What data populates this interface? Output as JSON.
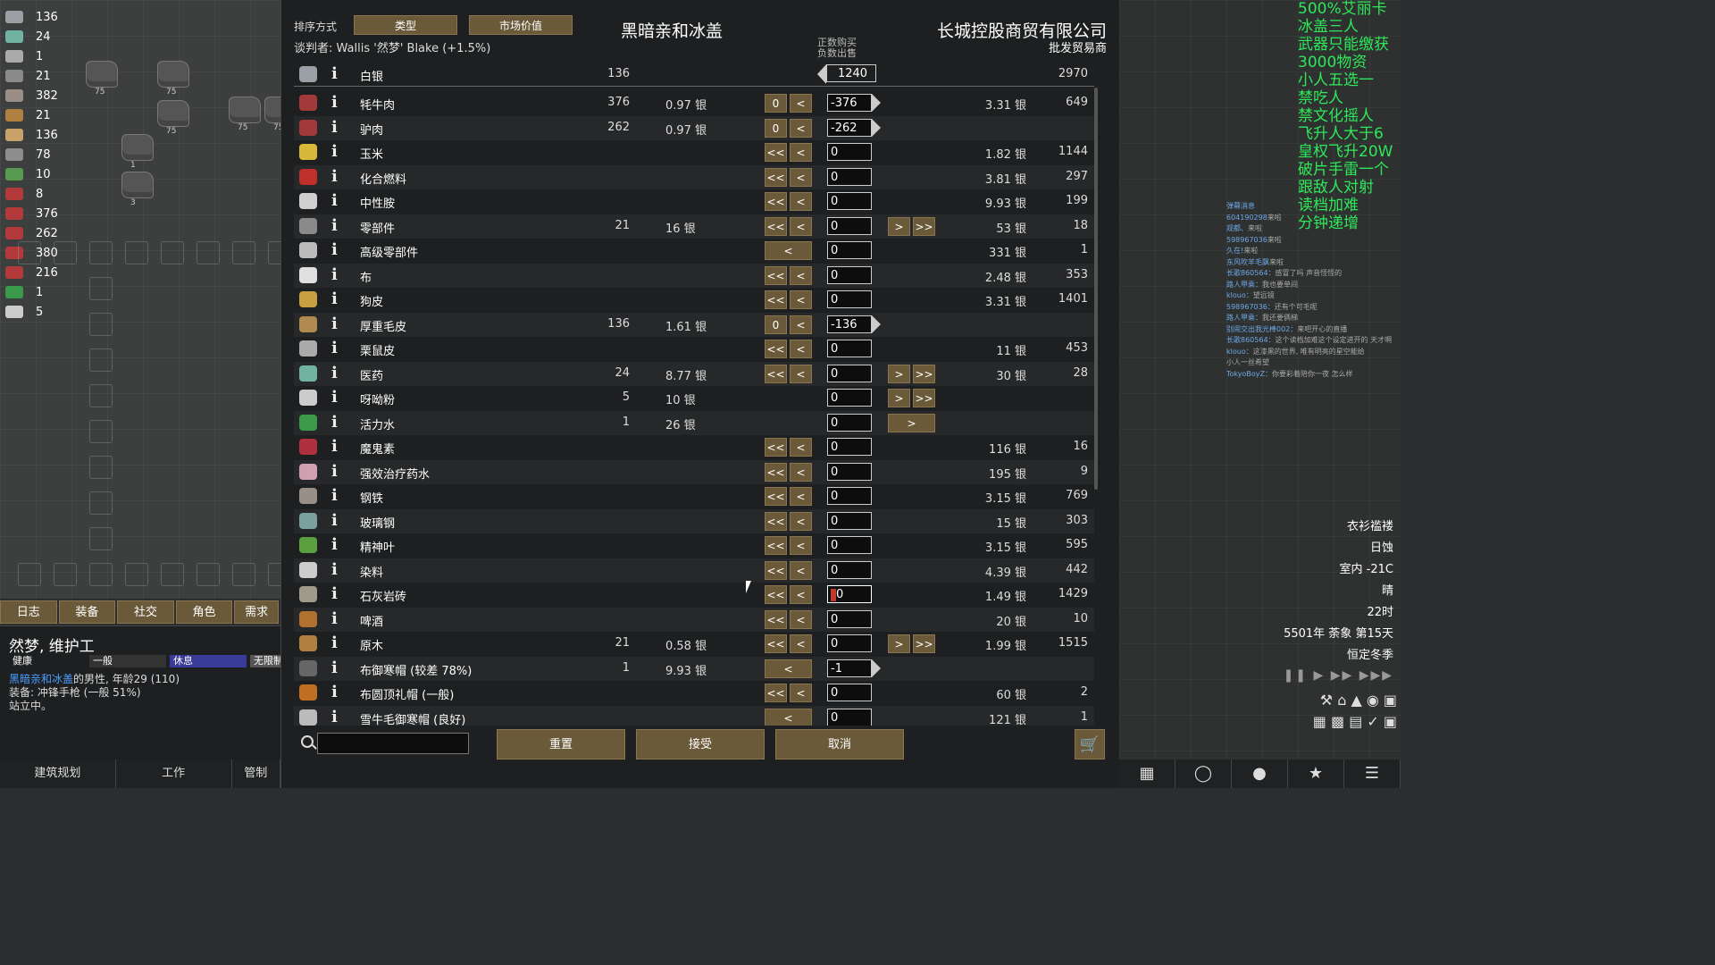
{
  "left_resources": [
    {
      "icon": "silver-icon",
      "count": "136",
      "color": "#9aa0a6"
    },
    {
      "icon": "medicine-icon",
      "count": "24",
      "color": "#6fb3a0"
    },
    {
      "icon": "yayo-icon",
      "count": "1",
      "color": "#aaaaaa"
    },
    {
      "icon": "components-icon",
      "count": "21",
      "color": "#8a8a8a"
    },
    {
      "icon": "steel-icon",
      "count": "382",
      "color": "#9a8f86"
    },
    {
      "icon": "wood-icon",
      "count": "21",
      "color": "#b08040"
    },
    {
      "icon": "leather-icon",
      "count": "136",
      "color": "#c9a26a"
    },
    {
      "icon": "dye-icon",
      "count": "78",
      "color": "#8d8d8d"
    },
    {
      "icon": "herb-icon",
      "count": "10",
      "color": "#5a9a50"
    },
    {
      "icon": "meat-icon",
      "count": "8",
      "color": "#b23a3a"
    },
    {
      "icon": "meat-icon",
      "count": "376",
      "color": "#b23a3a"
    },
    {
      "icon": "meat-icon",
      "count": "262",
      "color": "#b23a3a"
    },
    {
      "icon": "meat-icon",
      "count": "380",
      "color": "#b23a3a"
    },
    {
      "icon": "meat-icon",
      "count": "216",
      "color": "#b23a3a"
    },
    {
      "icon": "go-juice-icon",
      "count": "1",
      "color": "#3a9a4a"
    },
    {
      "icon": "flake-icon",
      "count": "5",
      "color": "#cccccc"
    }
  ],
  "map_rocks": [
    "75",
    "75",
    "75",
    "75",
    "1",
    "75",
    "3"
  ],
  "left_tabs": [
    "日志",
    "装备",
    "社交",
    "角色",
    "需求"
  ],
  "pawn": {
    "name": "然梦, 维护工",
    "needs": [
      "健康",
      "一般",
      "休息",
      "无限制"
    ],
    "faction_name": "黑暗亲和冰盖",
    "line1_rest": "的男性, 年龄29 (110)",
    "line2": "装备: 冲锋手枪 (一般 51%)",
    "line3": "站立中。"
  },
  "arch_tabs": [
    "建筑规划",
    "工作",
    "管制"
  ],
  "trade": {
    "sort_label": "排序方式",
    "sort_buttons": [
      "类型",
      "市场价值"
    ],
    "negotiator": "谈判者: Wallis '然梦' Blake (+1.5%)",
    "colony_name": "黑暗亲和冰盖",
    "trader_name": "长城控股商贸有限公司",
    "trader_kind": "批发贸易商",
    "buy_label": "正数购买",
    "sell_label": "负数出售",
    "silver": {
      "name": "白银",
      "colony": "136",
      "qty": "1240",
      "trader": "2970"
    },
    "rows": [
      {
        "icon": "meat-icon",
        "color": "#a33a3a",
        "name": "牦牛肉",
        "colony": "376",
        "cprice": "0.97 银",
        "left": "0",
        "qty": "-376",
        "arrow": true,
        "right": "",
        "tprice": "3.31 银",
        "tcount": "649"
      },
      {
        "icon": "meat-icon",
        "color": "#a33a3a",
        "name": "驴肉",
        "colony": "262",
        "cprice": "0.97 银",
        "left": "0",
        "qty": "-262",
        "arrow": true,
        "right": "",
        "tprice": "",
        "tcount": ""
      },
      {
        "icon": "corn-icon",
        "color": "#d8b83a",
        "name": "玉米",
        "colony": "",
        "cprice": "",
        "left": "<<",
        "qty": "0",
        "arrow": false,
        "right": "",
        "tprice": "1.82 银",
        "tcount": "1144"
      },
      {
        "icon": "chemfuel-icon",
        "color": "#c0302a",
        "name": "化合燃料",
        "colony": "",
        "cprice": "",
        "left": "<<",
        "qty": "0",
        "arrow": false,
        "right": "",
        "tprice": "3.81 银",
        "tcount": "297"
      },
      {
        "icon": "neutroamine-icon",
        "color": "#cfcfcf",
        "name": "中性胺",
        "colony": "",
        "cprice": "",
        "left": "<<",
        "qty": "0",
        "arrow": false,
        "right": "",
        "tprice": "9.93 银",
        "tcount": "199"
      },
      {
        "icon": "components-icon",
        "color": "#8a8a8a",
        "name": "零部件",
        "colony": "21",
        "cprice": "16 银",
        "left": "<<",
        "qty": "0",
        "arrow": false,
        "right": "both",
        "tprice": "53 银",
        "tcount": "18"
      },
      {
        "icon": "adv-components-icon",
        "color": "#bbbbbb",
        "name": "高级零部件",
        "colony": "",
        "cprice": "",
        "left": "<",
        "qty": "0",
        "arrow": false,
        "right": "",
        "tprice": "331 银",
        "tcount": "1"
      },
      {
        "icon": "cloth-icon",
        "color": "#e0e0e0",
        "name": "布",
        "colony": "",
        "cprice": "",
        "left": "<<",
        "qty": "0",
        "arrow": false,
        "right": "",
        "tprice": "2.48 银",
        "tcount": "353"
      },
      {
        "icon": "dogskin-icon",
        "color": "#c8a040",
        "name": "狗皮",
        "colony": "",
        "cprice": "",
        "left": "<<",
        "qty": "0",
        "arrow": false,
        "right": "",
        "tprice": "3.31 银",
        "tcount": "1401"
      },
      {
        "icon": "heavy-fur-icon",
        "color": "#b08a50",
        "name": "厚重毛皮",
        "colony": "136",
        "cprice": "1.61 银",
        "left": "0",
        "qty": "-136",
        "arrow": true,
        "right": "",
        "tprice": "",
        "tcount": ""
      },
      {
        "icon": "chinchilla-fur-icon",
        "color": "#aaaaaa",
        "name": "栗鼠皮",
        "colony": "",
        "cprice": "",
        "left": "<<",
        "qty": "0",
        "arrow": false,
        "right": "",
        "tprice": "11 银",
        "tcount": "453"
      },
      {
        "icon": "medicine-icon",
        "color": "#6fb3a0",
        "name": "医药",
        "colony": "24",
        "cprice": "8.77 银",
        "left": "<<",
        "qty": "0",
        "arrow": false,
        "right": "both",
        "tprice": "30 银",
        "tcount": "28"
      },
      {
        "icon": "yayo-icon",
        "color": "#cccccc",
        "name": "呀呦粉",
        "colony": "5",
        "cprice": "10 银",
        "left": "",
        "qty": "0",
        "arrow": false,
        "right": "both",
        "tprice": "",
        "tcount": ""
      },
      {
        "icon": "go-juice-icon",
        "color": "#3a9a4a",
        "name": "活力水",
        "colony": "1",
        "cprice": "26 银",
        "left": "",
        "qty": "0",
        "arrow": false,
        "right": "single",
        "tprice": "",
        "tcount": ""
      },
      {
        "icon": "luciferium-icon",
        "color": "#b03040",
        "name": "魔鬼素",
        "colony": "",
        "cprice": "",
        "left": "<<",
        "qty": "0",
        "arrow": false,
        "right": "",
        "tprice": "116 银",
        "tcount": "16"
      },
      {
        "icon": "healer-serum-icon",
        "color": "#d0a0b0",
        "name": "强效治疗药水",
        "colony": "",
        "cprice": "",
        "left": "<<",
        "qty": "0",
        "arrow": false,
        "right": "",
        "tprice": "195 银",
        "tcount": "9"
      },
      {
        "icon": "steel-icon",
        "color": "#9a8f86",
        "name": "钢铁",
        "colony": "",
        "cprice": "",
        "left": "<<",
        "qty": "0",
        "arrow": false,
        "right": "",
        "tprice": "3.15 银",
        "tcount": "769"
      },
      {
        "icon": "glass-steel-icon",
        "color": "#7aa0a0",
        "name": "玻璃钢",
        "colony": "",
        "cprice": "",
        "left": "<<",
        "qty": "0",
        "arrow": false,
        "right": "",
        "tprice": "15 银",
        "tcount": "303"
      },
      {
        "icon": "psychoid-leaf-icon",
        "color": "#5aa040",
        "name": "精神叶",
        "colony": "",
        "cprice": "",
        "left": "<<",
        "qty": "0",
        "arrow": false,
        "right": "",
        "tprice": "3.15 银",
        "tcount": "595"
      },
      {
        "icon": "dye-icon",
        "color": "#cccccc",
        "name": "染料",
        "colony": "",
        "cprice": "",
        "left": "<<",
        "qty": "0",
        "arrow": false,
        "right": "",
        "tprice": "4.39 银",
        "tcount": "442"
      },
      {
        "icon": "limestone-icon",
        "color": "#a09a8a",
        "name": "石灰岩砖",
        "colony": "",
        "cprice": "",
        "left": "<<",
        "qty": "0",
        "arrow": false,
        "right": "",
        "tprice": "1.49 银",
        "tcount": "1429",
        "editing": true
      },
      {
        "icon": "beer-icon",
        "color": "#b07030",
        "name": "啤酒",
        "colony": "",
        "cprice": "",
        "left": "<<",
        "qty": "0",
        "arrow": false,
        "right": "",
        "tprice": "20 银",
        "tcount": "10"
      },
      {
        "icon": "wood-icon",
        "color": "#b08040",
        "name": "原木",
        "colony": "21",
        "cprice": "0.58 银",
        "left": "<<",
        "qty": "0",
        "arrow": false,
        "right": "both",
        "tprice": "1.99 银",
        "tcount": "1515"
      },
      {
        "icon": "tuque-icon",
        "color": "#666666",
        "name": "布御寒帽 (较差 78%)",
        "colony": "1",
        "cprice": "9.93 银",
        "left": "<",
        "qty": "-1",
        "arrow": true,
        "right": "",
        "tprice": "",
        "tcount": ""
      },
      {
        "icon": "bowler-icon",
        "color": "#c07020",
        "name": "布圆顶礼帽 (一般)",
        "colony": "",
        "cprice": "",
        "left": "<<",
        "qty": "0",
        "arrow": false,
        "right": "",
        "tprice": "60 银",
        "tcount": "2"
      },
      {
        "icon": "tuque-icon",
        "color": "#bbbbbb",
        "name": "雪牛毛御寒帽 (良好)",
        "colony": "",
        "cprice": "",
        "left": "<",
        "qty": "0",
        "arrow": false,
        "right": "",
        "tprice": "121 银",
        "tcount": "1"
      }
    ],
    "buttons": {
      "reset": "重置",
      "accept": "接受",
      "cancel": "取消"
    }
  },
  "overlay_text": [
    "500%艾丽卡",
    "冰盖三人",
    "武器只能缴获",
    "3000物资",
    "小人五选一",
    "禁吃人",
    "禁文化摇人",
    "飞升人大于6",
    "皇权飞升20W",
    "破片手雷一个",
    "跟敌人对射",
    "读档加难",
    "分钟递增"
  ],
  "chat": [
    {
      "u": "弹幕消息",
      "t": ""
    },
    {
      "u": "604190298",
      "t": "来啦"
    },
    {
      "u": "观都、",
      "t": "来啦"
    },
    {
      "u": "598967036",
      "t": "来啦"
    },
    {
      "u": "久在!",
      "t": "来啦"
    },
    {
      "u": "东风吹羊毛飘",
      "t": "来啦"
    },
    {
      "u": "长歌860564：",
      "t": "感冒了吗 声音怪怪的"
    },
    {
      "u": "路人甲乘：",
      "t": "我也要单间"
    },
    {
      "u": "klouo：",
      "t": "望远镜"
    },
    {
      "u": "598967036：",
      "t": "还有个可毛呢"
    },
    {
      "u": "路人甲乘：",
      "t": "我还要俩梯"
    },
    {
      "u": "别闹交出我光棒002：",
      "t": "来吧开心的直播"
    },
    {
      "u": "长歌860564：",
      "t": "这个读档加难这个设定进开的 天才啊"
    },
    {
      "u": "klouo：",
      "t": "这漆黑的世界, 唯有明亮的星空能给"
    },
    {
      "u": "",
      "t": "小人一丝希望"
    },
    {
      "u": "TokyoBoyZ：",
      "t": "你要彩着陪你一夜 怎么样"
    }
  ],
  "weather": [
    "衣衫褴褛",
    "日蚀",
    "室内 -21C",
    "晴",
    "22时",
    "5501年 荼象 第15天",
    "恒定冬季"
  ]
}
